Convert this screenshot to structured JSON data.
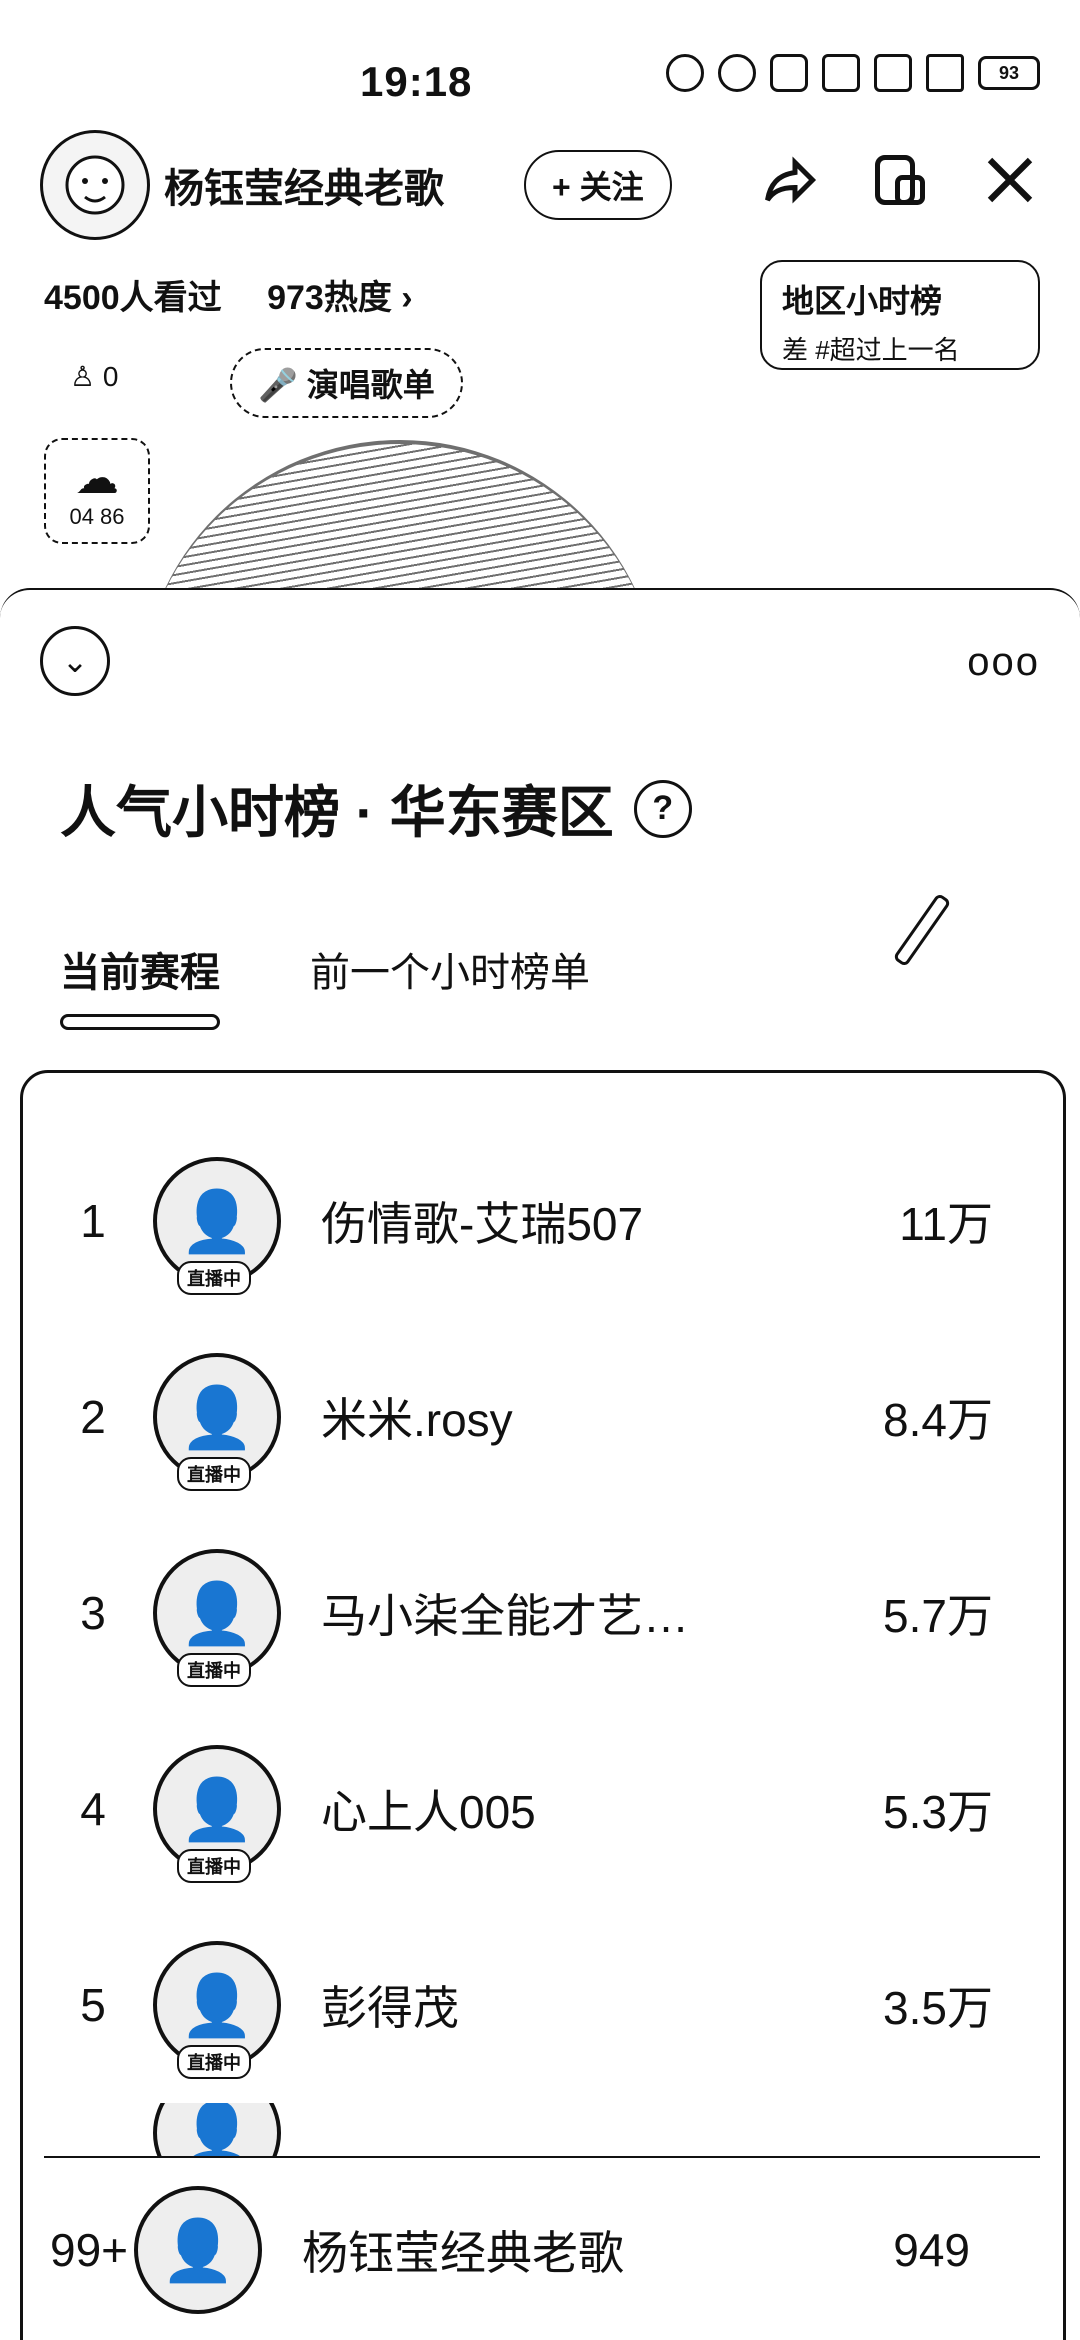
{
  "status": {
    "time": "19:18",
    "battery": "93"
  },
  "host": {
    "name": "杨钰莹经典老歌",
    "follow_label": "+ 关注"
  },
  "stats": {
    "viewers": "4500人看过",
    "heat": "973热度 ›"
  },
  "region_box": {
    "title": "地区小时榜",
    "subtitle": "差 #超过上一名"
  },
  "likes": "0",
  "songlist_label": "演唱歌单",
  "gift_count": "04 86",
  "panel": {
    "title": "人气小时榜 · 华东赛区",
    "more": "ooo",
    "tabs": [
      {
        "label": "当前赛程"
      },
      {
        "label": "前一个小时榜单"
      }
    ]
  },
  "live_badge": "直播中",
  "ranking": [
    {
      "rank": "1",
      "name": "伤情歌-艾瑞507",
      "score": "11万"
    },
    {
      "rank": "2",
      "name": "米米.rosy",
      "score": "8.4万"
    },
    {
      "rank": "3",
      "name": "马小柒全能才艺…",
      "score": "5.7万"
    },
    {
      "rank": "4",
      "name": "心上人005",
      "score": "5.3万"
    },
    {
      "rank": "5",
      "name": "彭得茂",
      "score": "3.5万"
    }
  ],
  "self_row": {
    "rank": "99+",
    "name": "杨钰莹经典老歌",
    "score": "949"
  }
}
